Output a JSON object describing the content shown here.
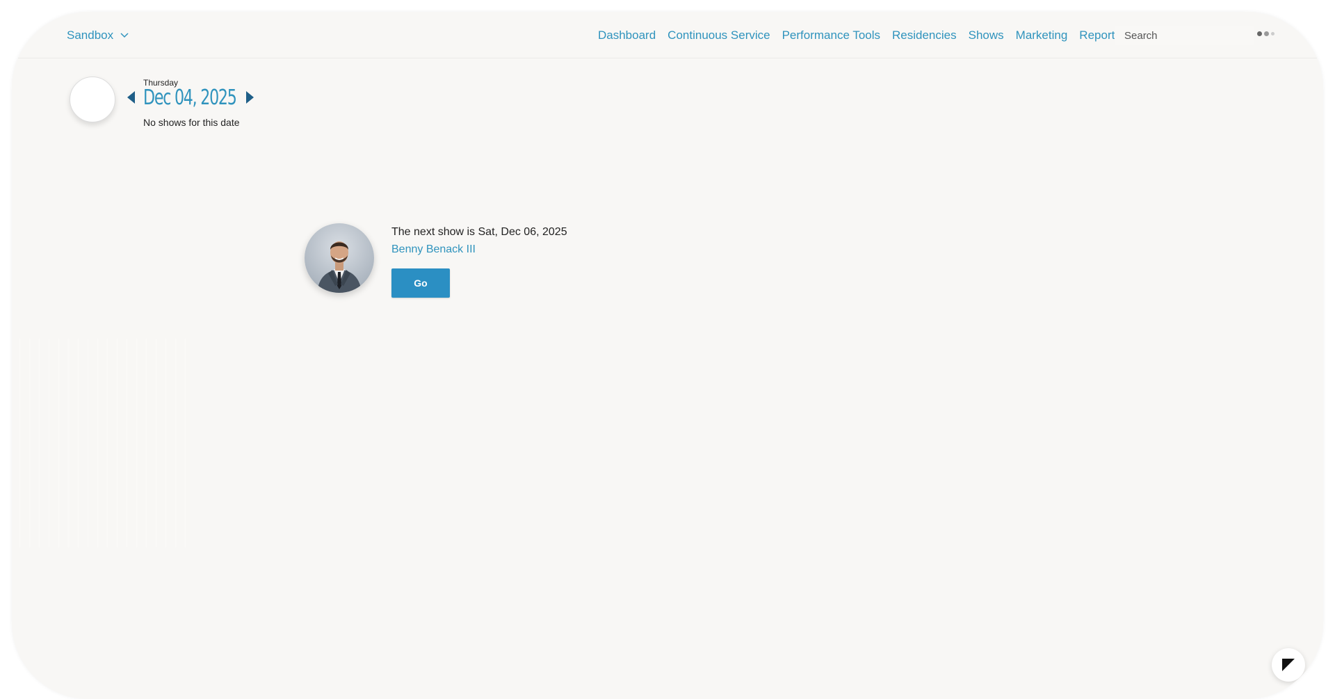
{
  "header": {
    "brand_label": "Sandbox",
    "nav": [
      {
        "label": "Dashboard"
      },
      {
        "label": "Continuous Service"
      },
      {
        "label": "Performance Tools"
      },
      {
        "label": "Residencies"
      },
      {
        "label": "Shows"
      },
      {
        "label": "Marketing"
      },
      {
        "label": "Reports"
      }
    ],
    "search_placeholder": "Search"
  },
  "date_panel": {
    "weekday": "Thursday",
    "date": "Dec 04, 2025",
    "status": "No shows for this date"
  },
  "next_show": {
    "text": "The next show is Sat, Dec 06, 2025",
    "performer": "Benny Benack III",
    "button_label": "Go"
  },
  "colors": {
    "accent": "#2f93bd",
    "button": "#2b8fc3",
    "arrow": "#1f5f88",
    "background": "#f8f7f5"
  }
}
